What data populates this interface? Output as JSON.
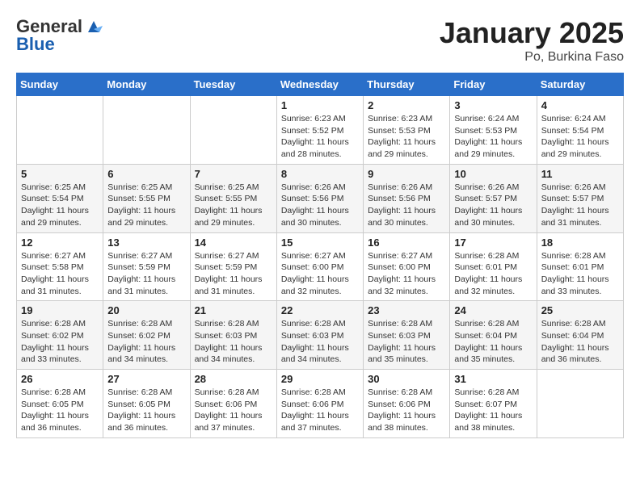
{
  "logo": {
    "general": "General",
    "blue": "Blue"
  },
  "header": {
    "month": "January 2025",
    "location": "Po, Burkina Faso"
  },
  "weekdays": [
    "Sunday",
    "Monday",
    "Tuesday",
    "Wednesday",
    "Thursday",
    "Friday",
    "Saturday"
  ],
  "weeks": [
    [
      {
        "day": "",
        "info": ""
      },
      {
        "day": "",
        "info": ""
      },
      {
        "day": "",
        "info": ""
      },
      {
        "day": "1",
        "info": "Sunrise: 6:23 AM\nSunset: 5:52 PM\nDaylight: 11 hours and 28 minutes."
      },
      {
        "day": "2",
        "info": "Sunrise: 6:23 AM\nSunset: 5:53 PM\nDaylight: 11 hours and 29 minutes."
      },
      {
        "day": "3",
        "info": "Sunrise: 6:24 AM\nSunset: 5:53 PM\nDaylight: 11 hours and 29 minutes."
      },
      {
        "day": "4",
        "info": "Sunrise: 6:24 AM\nSunset: 5:54 PM\nDaylight: 11 hours and 29 minutes."
      }
    ],
    [
      {
        "day": "5",
        "info": "Sunrise: 6:25 AM\nSunset: 5:54 PM\nDaylight: 11 hours and 29 minutes."
      },
      {
        "day": "6",
        "info": "Sunrise: 6:25 AM\nSunset: 5:55 PM\nDaylight: 11 hours and 29 minutes."
      },
      {
        "day": "7",
        "info": "Sunrise: 6:25 AM\nSunset: 5:55 PM\nDaylight: 11 hours and 29 minutes."
      },
      {
        "day": "8",
        "info": "Sunrise: 6:26 AM\nSunset: 5:56 PM\nDaylight: 11 hours and 30 minutes."
      },
      {
        "day": "9",
        "info": "Sunrise: 6:26 AM\nSunset: 5:56 PM\nDaylight: 11 hours and 30 minutes."
      },
      {
        "day": "10",
        "info": "Sunrise: 6:26 AM\nSunset: 5:57 PM\nDaylight: 11 hours and 30 minutes."
      },
      {
        "day": "11",
        "info": "Sunrise: 6:26 AM\nSunset: 5:57 PM\nDaylight: 11 hours and 31 minutes."
      }
    ],
    [
      {
        "day": "12",
        "info": "Sunrise: 6:27 AM\nSunset: 5:58 PM\nDaylight: 11 hours and 31 minutes."
      },
      {
        "day": "13",
        "info": "Sunrise: 6:27 AM\nSunset: 5:59 PM\nDaylight: 11 hours and 31 minutes."
      },
      {
        "day": "14",
        "info": "Sunrise: 6:27 AM\nSunset: 5:59 PM\nDaylight: 11 hours and 31 minutes."
      },
      {
        "day": "15",
        "info": "Sunrise: 6:27 AM\nSunset: 6:00 PM\nDaylight: 11 hours and 32 minutes."
      },
      {
        "day": "16",
        "info": "Sunrise: 6:27 AM\nSunset: 6:00 PM\nDaylight: 11 hours and 32 minutes."
      },
      {
        "day": "17",
        "info": "Sunrise: 6:28 AM\nSunset: 6:01 PM\nDaylight: 11 hours and 32 minutes."
      },
      {
        "day": "18",
        "info": "Sunrise: 6:28 AM\nSunset: 6:01 PM\nDaylight: 11 hours and 33 minutes."
      }
    ],
    [
      {
        "day": "19",
        "info": "Sunrise: 6:28 AM\nSunset: 6:02 PM\nDaylight: 11 hours and 33 minutes."
      },
      {
        "day": "20",
        "info": "Sunrise: 6:28 AM\nSunset: 6:02 PM\nDaylight: 11 hours and 34 minutes."
      },
      {
        "day": "21",
        "info": "Sunrise: 6:28 AM\nSunset: 6:03 PM\nDaylight: 11 hours and 34 minutes."
      },
      {
        "day": "22",
        "info": "Sunrise: 6:28 AM\nSunset: 6:03 PM\nDaylight: 11 hours and 34 minutes."
      },
      {
        "day": "23",
        "info": "Sunrise: 6:28 AM\nSunset: 6:03 PM\nDaylight: 11 hours and 35 minutes."
      },
      {
        "day": "24",
        "info": "Sunrise: 6:28 AM\nSunset: 6:04 PM\nDaylight: 11 hours and 35 minutes."
      },
      {
        "day": "25",
        "info": "Sunrise: 6:28 AM\nSunset: 6:04 PM\nDaylight: 11 hours and 36 minutes."
      }
    ],
    [
      {
        "day": "26",
        "info": "Sunrise: 6:28 AM\nSunset: 6:05 PM\nDaylight: 11 hours and 36 minutes."
      },
      {
        "day": "27",
        "info": "Sunrise: 6:28 AM\nSunset: 6:05 PM\nDaylight: 11 hours and 36 minutes."
      },
      {
        "day": "28",
        "info": "Sunrise: 6:28 AM\nSunset: 6:06 PM\nDaylight: 11 hours and 37 minutes."
      },
      {
        "day": "29",
        "info": "Sunrise: 6:28 AM\nSunset: 6:06 PM\nDaylight: 11 hours and 37 minutes."
      },
      {
        "day": "30",
        "info": "Sunrise: 6:28 AM\nSunset: 6:06 PM\nDaylight: 11 hours and 38 minutes."
      },
      {
        "day": "31",
        "info": "Sunrise: 6:28 AM\nSunset: 6:07 PM\nDaylight: 11 hours and 38 minutes."
      },
      {
        "day": "",
        "info": ""
      }
    ]
  ]
}
